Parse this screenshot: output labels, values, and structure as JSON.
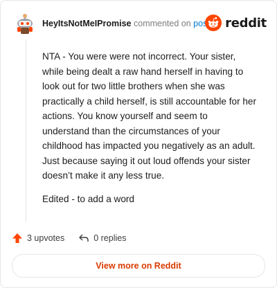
{
  "comment": {
    "username": "HeyItsNotMeIPromise",
    "action_text": "commented on",
    "post_link": "post",
    "paragraphs": [
      "NTA - You were were not incorrect. Your sister, while being dealt a raw hand herself in having to look out for two little brothers when she was practically a child herself, is still accountable for her actions. You know yourself and seem to understand than the circumstances of your childhood has impacted you negatively as an adult. Just because saying it out loud offends your sister doesn’t make it any less true.",
      "Edited - to add a word"
    ]
  },
  "brand": {
    "wordmark": "reddit",
    "color": "#ff4500"
  },
  "actions": {
    "upvotes": "3 upvotes",
    "replies": "0 replies"
  },
  "footer": {
    "view_more": "View more on Reddit"
  },
  "icons": {
    "avatar": "snoo-avatar-icon",
    "upvote": "upvote-arrow-icon",
    "reply": "reply-arrow-icon",
    "logo": "reddit-logo-icon"
  }
}
